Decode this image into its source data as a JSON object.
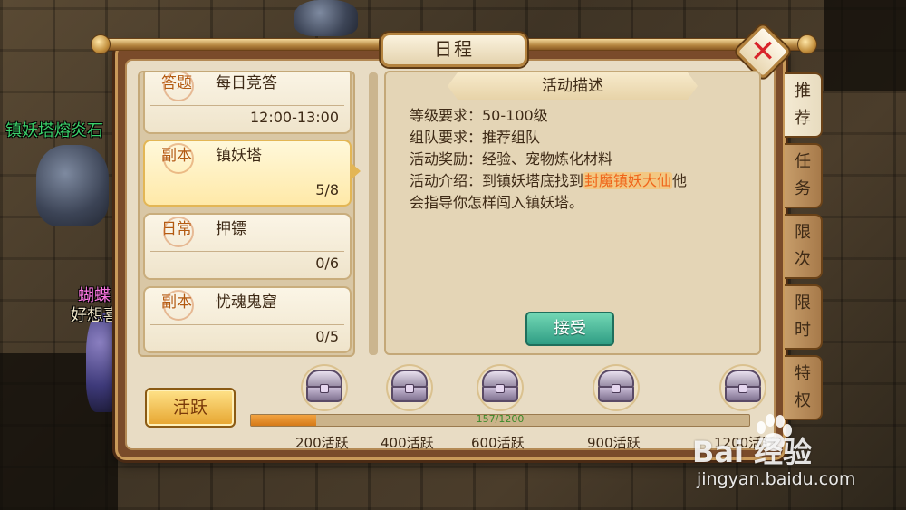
{
  "window": {
    "title": "日程"
  },
  "world": {
    "npc_label": "镇妖塔熔炎石",
    "player_label_top": "蝴蝶",
    "player_label_bottom": "好想喜"
  },
  "activities": [
    {
      "tag": "答题",
      "name": "每日竞答",
      "meta": "12:00-13:00",
      "selected": false
    },
    {
      "tag": "副本",
      "name": "镇妖塔",
      "meta": "5/8",
      "selected": true
    },
    {
      "tag": "日常",
      "name": "押镖",
      "meta": "0/6",
      "selected": false
    },
    {
      "tag": "副本",
      "name": "忧魂鬼窟",
      "meta": "0/5",
      "selected": false
    }
  ],
  "description": {
    "header": "活动描述",
    "level": "等级要求：50-100级",
    "team": "组队要求：推荐组队",
    "reward": "活动奖励：经验、宠物炼化材料",
    "intro_prefix": "活动介绍：到镇妖塔底找到",
    "intro_highlight": "封魔镇妖大仙",
    "intro_suffix": "他",
    "intro_line2": "会指导你怎样闯入镇妖塔。",
    "accept_label": "接受"
  },
  "side_tabs": [
    {
      "label": "推荐",
      "active": true
    },
    {
      "label": "任务",
      "active": false
    },
    {
      "label": "限次",
      "active": false
    },
    {
      "label": "限时",
      "active": false
    },
    {
      "label": "特权",
      "active": false
    }
  ],
  "activity_bar": {
    "button_label": "活跃",
    "progress_text": "157/1200",
    "progress_fraction": 0.131,
    "chest_labels": [
      "200活跃",
      "400活跃",
      "600活跃",
      "900活跃",
      "1200活跃"
    ]
  },
  "watermark": {
    "logo": "Bai 经验",
    "url": "jingyan.baidu.com"
  },
  "colors": {
    "panel": "#e8dcc4",
    "accept_button": "#3fae8f",
    "highlight_text": "#f0651a",
    "npc_green": "#3bd06a"
  }
}
